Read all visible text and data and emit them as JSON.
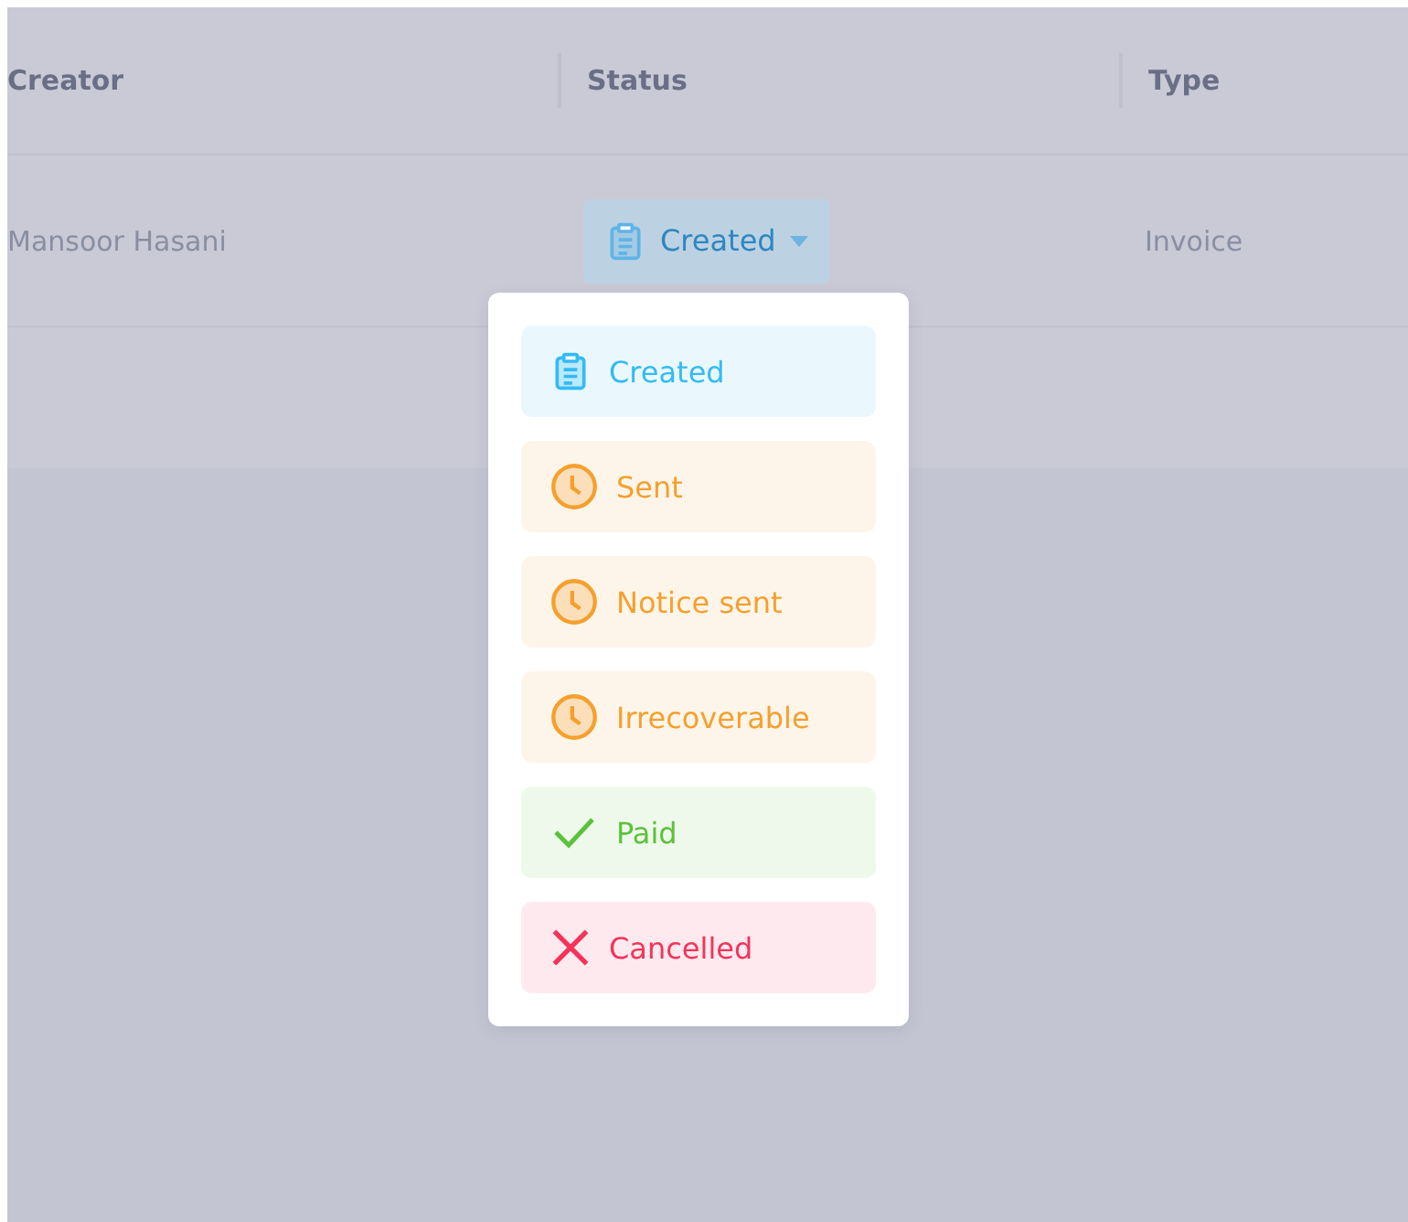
{
  "table": {
    "columns": [
      "Creator",
      "Status",
      "Type"
    ],
    "rows": [
      {
        "creator": "Mansoor Hasani",
        "status": {
          "label": "Created",
          "kind": "created"
        },
        "type": "Invoice"
      }
    ]
  },
  "status_menu": {
    "items": [
      {
        "label": "Created",
        "kind": "created",
        "color": "#33bbf5"
      },
      {
        "label": "Sent",
        "kind": "pending",
        "color": "#f5a02d"
      },
      {
        "label": "Notice sent",
        "kind": "pending",
        "color": "#f5a02d"
      },
      {
        "label": "Irrecoverable",
        "kind": "pending",
        "color": "#f5a02d"
      },
      {
        "label": "Paid",
        "kind": "paid",
        "color": "#5cc23a"
      },
      {
        "label": "Cancelled",
        "kind": "cancelled",
        "color": "#f5335a"
      }
    ]
  }
}
